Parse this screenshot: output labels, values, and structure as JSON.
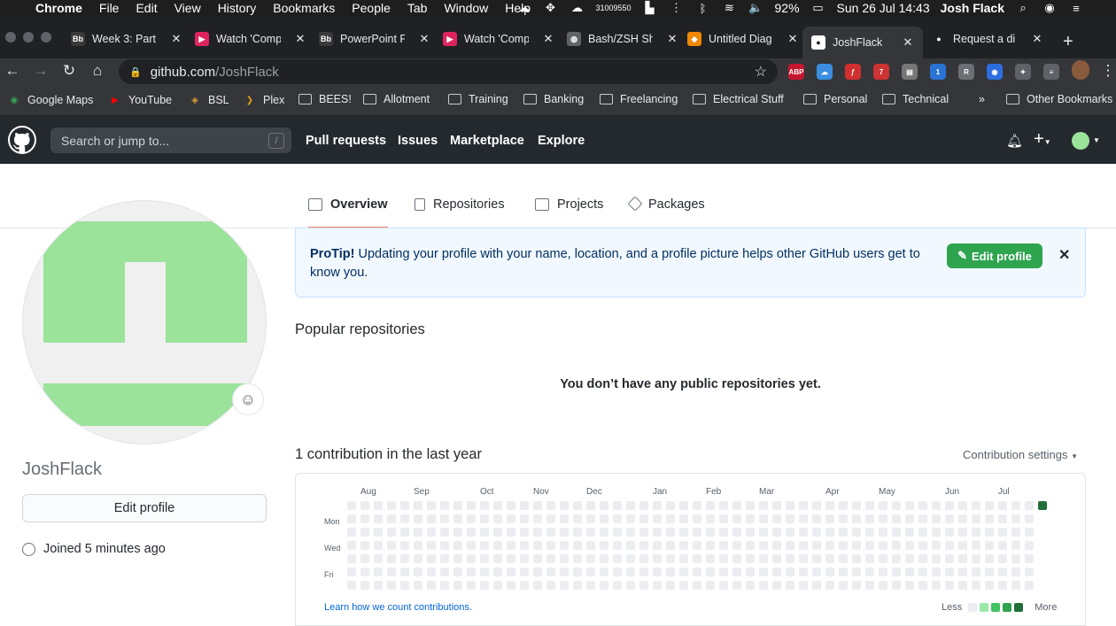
{
  "macos": {
    "apple": "",
    "menus": [
      "Chrome",
      "File",
      "Edit",
      "View",
      "History",
      "Bookmarks",
      "People",
      "Tab",
      "Window",
      "Help"
    ],
    "counter": "31009550",
    "battery": "92%",
    "datetime": "Sun 26 Jul  14:43",
    "user": "Josh Flack"
  },
  "tabs": [
    {
      "title": "Week 3: Part",
      "favicon": "Bb",
      "color": "#3a3a3a"
    },
    {
      "title": "Watch 'Comp",
      "favicon": "▶",
      "color": "#e0245e"
    },
    {
      "title": "PowerPoint P",
      "favicon": "Bb",
      "color": "#3a3a3a"
    },
    {
      "title": "Watch 'Comp",
      "favicon": "▶",
      "color": "#e0245e"
    },
    {
      "title": "Bash/ZSH Sh",
      "favicon": "◍",
      "color": "#5f6368"
    },
    {
      "title": "Untitled Diag",
      "favicon": "◆",
      "color": "#f08705"
    },
    {
      "title": "JoshFlack",
      "favicon": "●",
      "color": "#ffffff",
      "active": true
    },
    {
      "title": "Request a di",
      "favicon": "●",
      "color": "#202124"
    }
  ],
  "address": {
    "host": "github.com",
    "path": "/JoshFlack"
  },
  "extensions": [
    {
      "label": "ABP",
      "color": "#c5162e"
    },
    {
      "label": "☁",
      "color": "#3b8ee0"
    },
    {
      "label": "ƒ",
      "color": "#d12f2f"
    },
    {
      "label": "7",
      "color": "#c33"
    },
    {
      "label": "▤",
      "color": "#777"
    },
    {
      "label": "1",
      "color": "#2a72d4"
    },
    {
      "label": "R",
      "color": "#6c6f73"
    },
    {
      "label": "◉",
      "color": "#2c6de0"
    },
    {
      "label": "✦",
      "color": "#5f6368"
    },
    {
      "label": "≡",
      "color": "#5f6368"
    }
  ],
  "bookmarks": [
    "Google Maps",
    "YouTube",
    "BSL",
    "Plex",
    "BEES!",
    "Allotment",
    "Training",
    "Banking",
    "Freelancing",
    "Electrical Stuff",
    "Personal",
    "Technical"
  ],
  "bookmarks_more": "»",
  "other_bookmarks": "Other Bookmarks",
  "github": {
    "search_placeholder": "Search or jump to...",
    "search_key": "/",
    "nav": [
      "Pull requests",
      "Issues",
      "Marketplace",
      "Explore"
    ]
  },
  "profile_tabs": [
    "Overview",
    "Repositories",
    "Projects",
    "Packages"
  ],
  "profile": {
    "username": "JoshFlack",
    "edit_label": "Edit profile",
    "joined": "Joined 5 minutes ago"
  },
  "protip": {
    "bold": "ProTip!",
    "text": " Updating your profile with your name, location, and a profile picture helps other GitHub users get to know you.",
    "button": "Edit profile"
  },
  "popular_title": "Popular repositories",
  "no_repos": "You don’t have any public repositories yet.",
  "contrib": {
    "title": "1 contribution in the last year",
    "settings": "Contribution settings",
    "months": [
      "Aug",
      "Sep",
      "Oct",
      "Nov",
      "Dec",
      "Jan",
      "Feb",
      "Mar",
      "Apr",
      "May",
      "Jun",
      "Jul"
    ],
    "days": [
      "Mon",
      "Wed",
      "Fri"
    ],
    "weeks": 52,
    "contribution_day": "Sun 26 Jul",
    "learn": "Learn how we count contributions.",
    "less": "Less",
    "more": "More",
    "colors": [
      "#ebedf0",
      "#9be9a8",
      "#40c463",
      "#30a14e",
      "#216e39"
    ]
  }
}
